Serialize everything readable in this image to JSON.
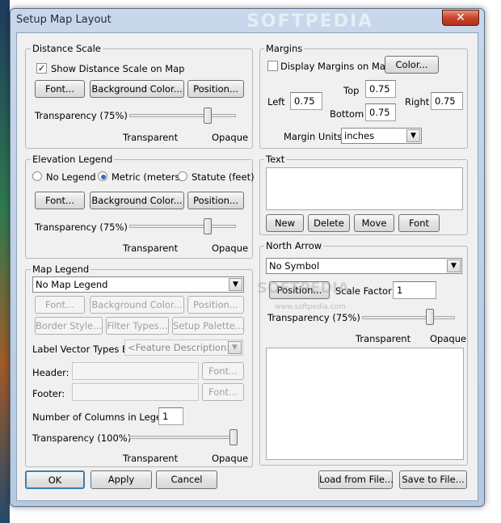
{
  "window": {
    "title": "Setup Map Layout",
    "close_glyph": "✕",
    "watermark": "SOFTPEDIA",
    "watermark_mid": "SOFTPEDIA",
    "watermark_url": "www.softpedia.com"
  },
  "distance_scale": {
    "label": "Distance Scale",
    "show_label": "Show Distance Scale on Map",
    "show_checked": true,
    "font_btn": "Font...",
    "background_btn": "Background Color...",
    "position_btn": "Position...",
    "transparency_label": "Transparency (75%)",
    "transparency_value": 75,
    "transparent_label": "Transparent",
    "opaque_label": "Opaque"
  },
  "margins": {
    "label": "Margins",
    "display_label": "Display Margins on Map",
    "display_checked": false,
    "color_btn": "Color...",
    "top_label": "Top",
    "top_value": "0.75",
    "left_label": "Left",
    "left_value": "0.75",
    "bottom_label": "Bottom",
    "bottom_value": "0.75",
    "right_label": "Right",
    "right_value": "0.75",
    "units_label": "Margin Units:",
    "units_value": "inches"
  },
  "elevation_legend": {
    "label": "Elevation Legend",
    "radio_none": "No Legend",
    "radio_metric": "Metric (meters)",
    "radio_statute": "Statute (feet)",
    "selected": "metric",
    "font_btn": "Font...",
    "background_btn": "Background Color...",
    "position_btn": "Position...",
    "transparency_label": "Transparency (75%)",
    "transparency_value": 75,
    "transparent_label": "Transparent",
    "opaque_label": "Opaque"
  },
  "text": {
    "label": "Text",
    "new_btn": "New",
    "delete_btn": "Delete",
    "move_btn": "Move",
    "font_btn": "Font"
  },
  "map_legend": {
    "label": "Map Legend",
    "legend_select": "No Map Legend",
    "font_btn": "Font...",
    "background_btn": "Background Color...",
    "position_btn": "Position...",
    "border_btn": "Border Style...",
    "filter_btn": "Filter Types...",
    "palette_btn": "Setup Palette...",
    "vector_label": "Label Vector Types By:",
    "vector_value": "<Feature Description>",
    "header_label": "Header:",
    "header_font_btn": "Font...",
    "footer_label": "Footer:",
    "footer_font_btn": "Font...",
    "columns_label": "Number of Columns in Legend:",
    "columns_value": "1",
    "transparency_label": "Transparency (100%)",
    "transparency_value": 100,
    "transparent_label": "Transparent",
    "opaque_label": "Opaque"
  },
  "north_arrow": {
    "label": "North Arrow",
    "symbol_select": "No Symbol",
    "position_btn": "Position...",
    "scale_label": "Scale Factor:",
    "scale_value": "1",
    "transparency_label": "Transparency (75%)",
    "transparency_value": 75,
    "transparent_label": "Transparent",
    "opaque_label": "Opaque"
  },
  "footer": {
    "ok_btn": "OK",
    "apply_btn": "Apply",
    "cancel_btn": "Cancel",
    "load_btn": "Load from File...",
    "save_btn": "Save to File..."
  },
  "icons": {
    "checkmark": "✓",
    "dropdown": "▼"
  }
}
